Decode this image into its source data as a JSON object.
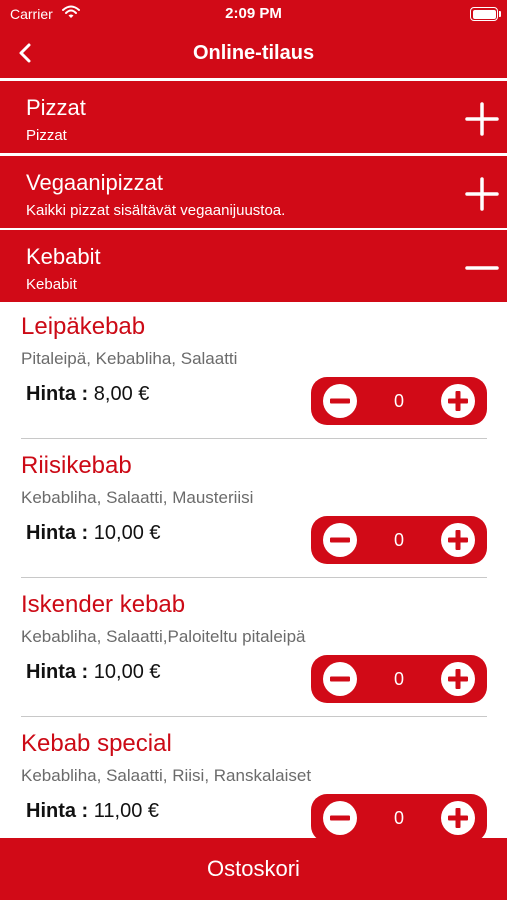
{
  "status": {
    "carrier": "Carrier",
    "time": "2:09 PM"
  },
  "nav": {
    "title": "Online-tilaus"
  },
  "categories": [
    {
      "title": "Pizzat",
      "subtitle": "Pizzat",
      "expanded": false
    },
    {
      "title": "Vegaanipizzat",
      "subtitle": "Kaikki pizzat sisältävät vegaanijuustoa.",
      "expanded": false
    },
    {
      "title": "Kebabit",
      "subtitle": "Kebabit",
      "expanded": true
    }
  ],
  "items": [
    {
      "name": "Leipäkebab",
      "desc": "Pitaleipä, Kebabliha, Salaatti",
      "price_label": "Hinta :",
      "price": "8,00 €",
      "qty": "0"
    },
    {
      "name": "Riisikebab",
      "desc": "Kebabliha, Salaatti, Mausteriisi",
      "price_label": "Hinta :",
      "price": "10,00 €",
      "qty": "0"
    },
    {
      "name": "Iskender kebab",
      "desc": "Kebabliha, Salaatti,Paloiteltu pitaleipä",
      "price_label": "Hinta :",
      "price": "10,00 €",
      "qty": "0"
    },
    {
      "name": "Kebab special",
      "desc": "Kebabliha, Salaatti, Riisi, Ranskalaiset",
      "price_label": "Hinta :",
      "price": "11,00 €",
      "qty": "0"
    }
  ],
  "cart": {
    "label": "Ostoskori"
  },
  "colors": {
    "accent": "#d10a17",
    "item_title": "#cc0a16",
    "desc": "#6b6b6b"
  }
}
